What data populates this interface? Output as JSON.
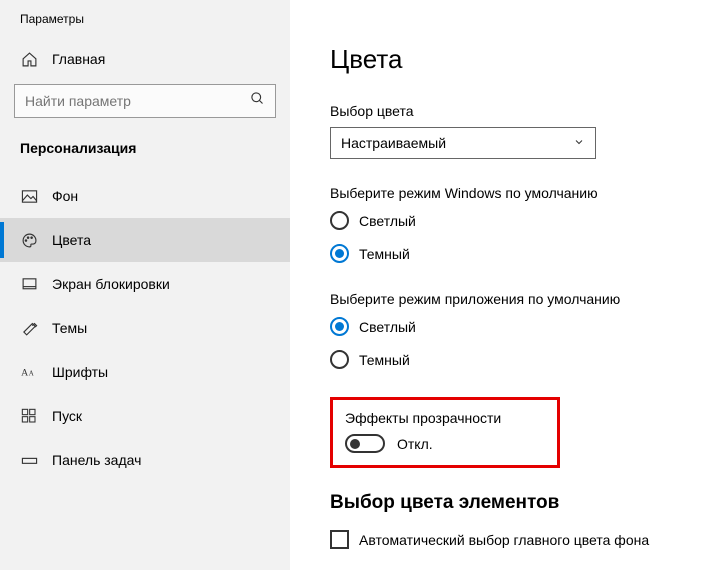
{
  "app_title": "Параметры",
  "home_label": "Главная",
  "search": {
    "placeholder": "Найти параметр"
  },
  "section_title": "Персонализация",
  "nav": {
    "background": "Фон",
    "colors": "Цвета",
    "lockscreen": "Экран блокировки",
    "themes": "Темы",
    "fonts": "Шрифты",
    "start": "Пуск",
    "taskbar": "Панель задач"
  },
  "page": {
    "title": "Цвета",
    "color_choice_label": "Выбор цвета",
    "color_choice_value": "Настраиваемый",
    "win_mode_label": "Выберите режим Windows по умолчанию",
    "light": "Светлый",
    "dark": "Темный",
    "app_mode_label": "Выберите режим приложения по умолчанию",
    "transparency_label": "Эффекты прозрачности",
    "toggle_state": "Откл.",
    "accent_heading": "Выбор цвета элементов",
    "auto_accent": "Автоматический выбор главного цвета фона"
  }
}
